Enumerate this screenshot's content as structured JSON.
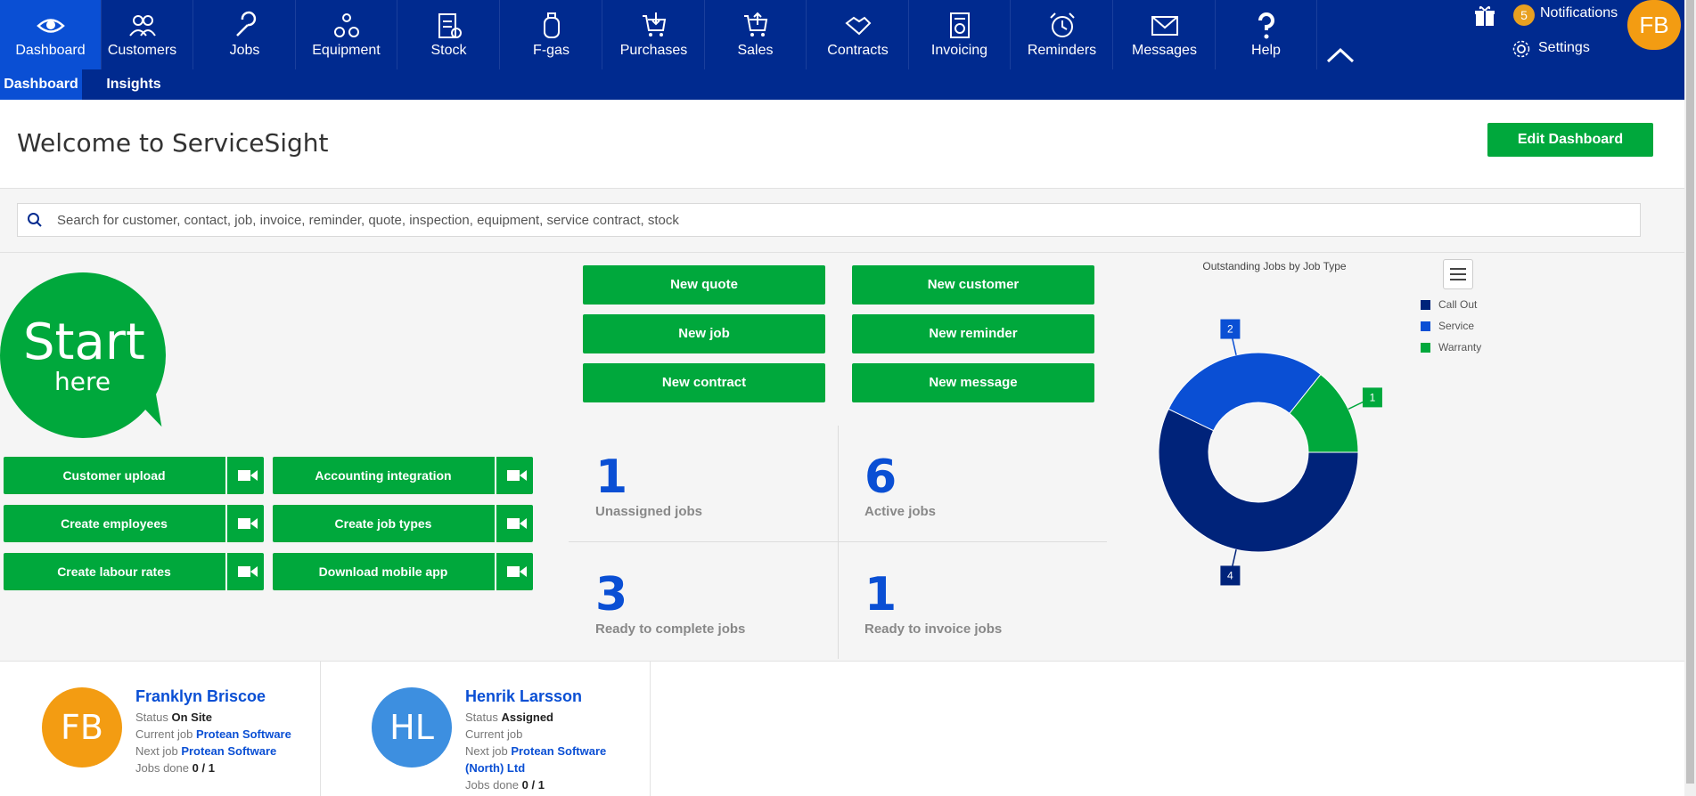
{
  "nav": {
    "items": [
      {
        "label": "Dashboard"
      },
      {
        "label": "Customers"
      },
      {
        "label": "Jobs"
      },
      {
        "label": "Equipment"
      },
      {
        "label": "Stock"
      },
      {
        "label": "F-gas"
      },
      {
        "label": "Purchases"
      },
      {
        "label": "Sales"
      },
      {
        "label": "Contracts"
      },
      {
        "label": "Invoicing"
      },
      {
        "label": "Reminders"
      },
      {
        "label": "Messages"
      },
      {
        "label": "Help"
      }
    ],
    "notifications_count": "5",
    "notifications_label": "Notifications",
    "settings_label": "Settings",
    "user_initials": "FB"
  },
  "subnav": {
    "tabs": [
      {
        "label": "Dashboard"
      },
      {
        "label": "Insights"
      }
    ]
  },
  "welcome": {
    "title": "Welcome to ServiceSight",
    "edit_label": "Edit Dashboard"
  },
  "search": {
    "placeholder": "Search for customer, contact, job, invoice, reminder, quote, inspection, equipment, service contract, stock"
  },
  "start": {
    "big": "Start",
    "small": "here"
  },
  "setup": [
    {
      "label": "Customer upload"
    },
    {
      "label": "Accounting integration"
    },
    {
      "label": "Create employees"
    },
    {
      "label": "Create job types"
    },
    {
      "label": "Create labour rates"
    },
    {
      "label": "Download mobile app"
    }
  ],
  "actions": [
    {
      "label": "New quote"
    },
    {
      "label": "New customer"
    },
    {
      "label": "New job"
    },
    {
      "label": "New reminder"
    },
    {
      "label": "New contract"
    },
    {
      "label": "New message"
    }
  ],
  "stats": [
    {
      "value": "1",
      "label": "Unassigned jobs"
    },
    {
      "value": "6",
      "label": "Active jobs"
    },
    {
      "value": "3",
      "label": "Ready to complete jobs"
    },
    {
      "value": "1",
      "label": "Ready to invoice jobs"
    }
  ],
  "chart_data": {
    "type": "pie",
    "title": "Outstanding Jobs by Job Type",
    "categories": [
      "Call Out",
      "Service",
      "Warranty"
    ],
    "values": [
      4,
      2,
      1
    ],
    "colors": [
      "#00237a",
      "#0a4fd4",
      "#00a83c"
    ],
    "legend": "top-right"
  },
  "employees": [
    {
      "initials": "FB",
      "color": "#f39c12",
      "name": "Franklyn Briscoe",
      "status_key": "Status",
      "status": "On Site",
      "current_key": "Current job",
      "current_job": "Protean Software",
      "next_key": "Next job",
      "next_job": "Protean Software",
      "done_key": "Jobs done",
      "done": "0 / 1"
    },
    {
      "initials": "HL",
      "color": "#3d8fe0",
      "name": "Henrik Larsson",
      "status_key": "Status",
      "status": "Assigned",
      "current_key": "Current job",
      "current_job": "",
      "next_key": "Next job",
      "next_job": "Protean Software (North) Ltd",
      "done_key": "Jobs done",
      "done": "0 / 1"
    }
  ]
}
